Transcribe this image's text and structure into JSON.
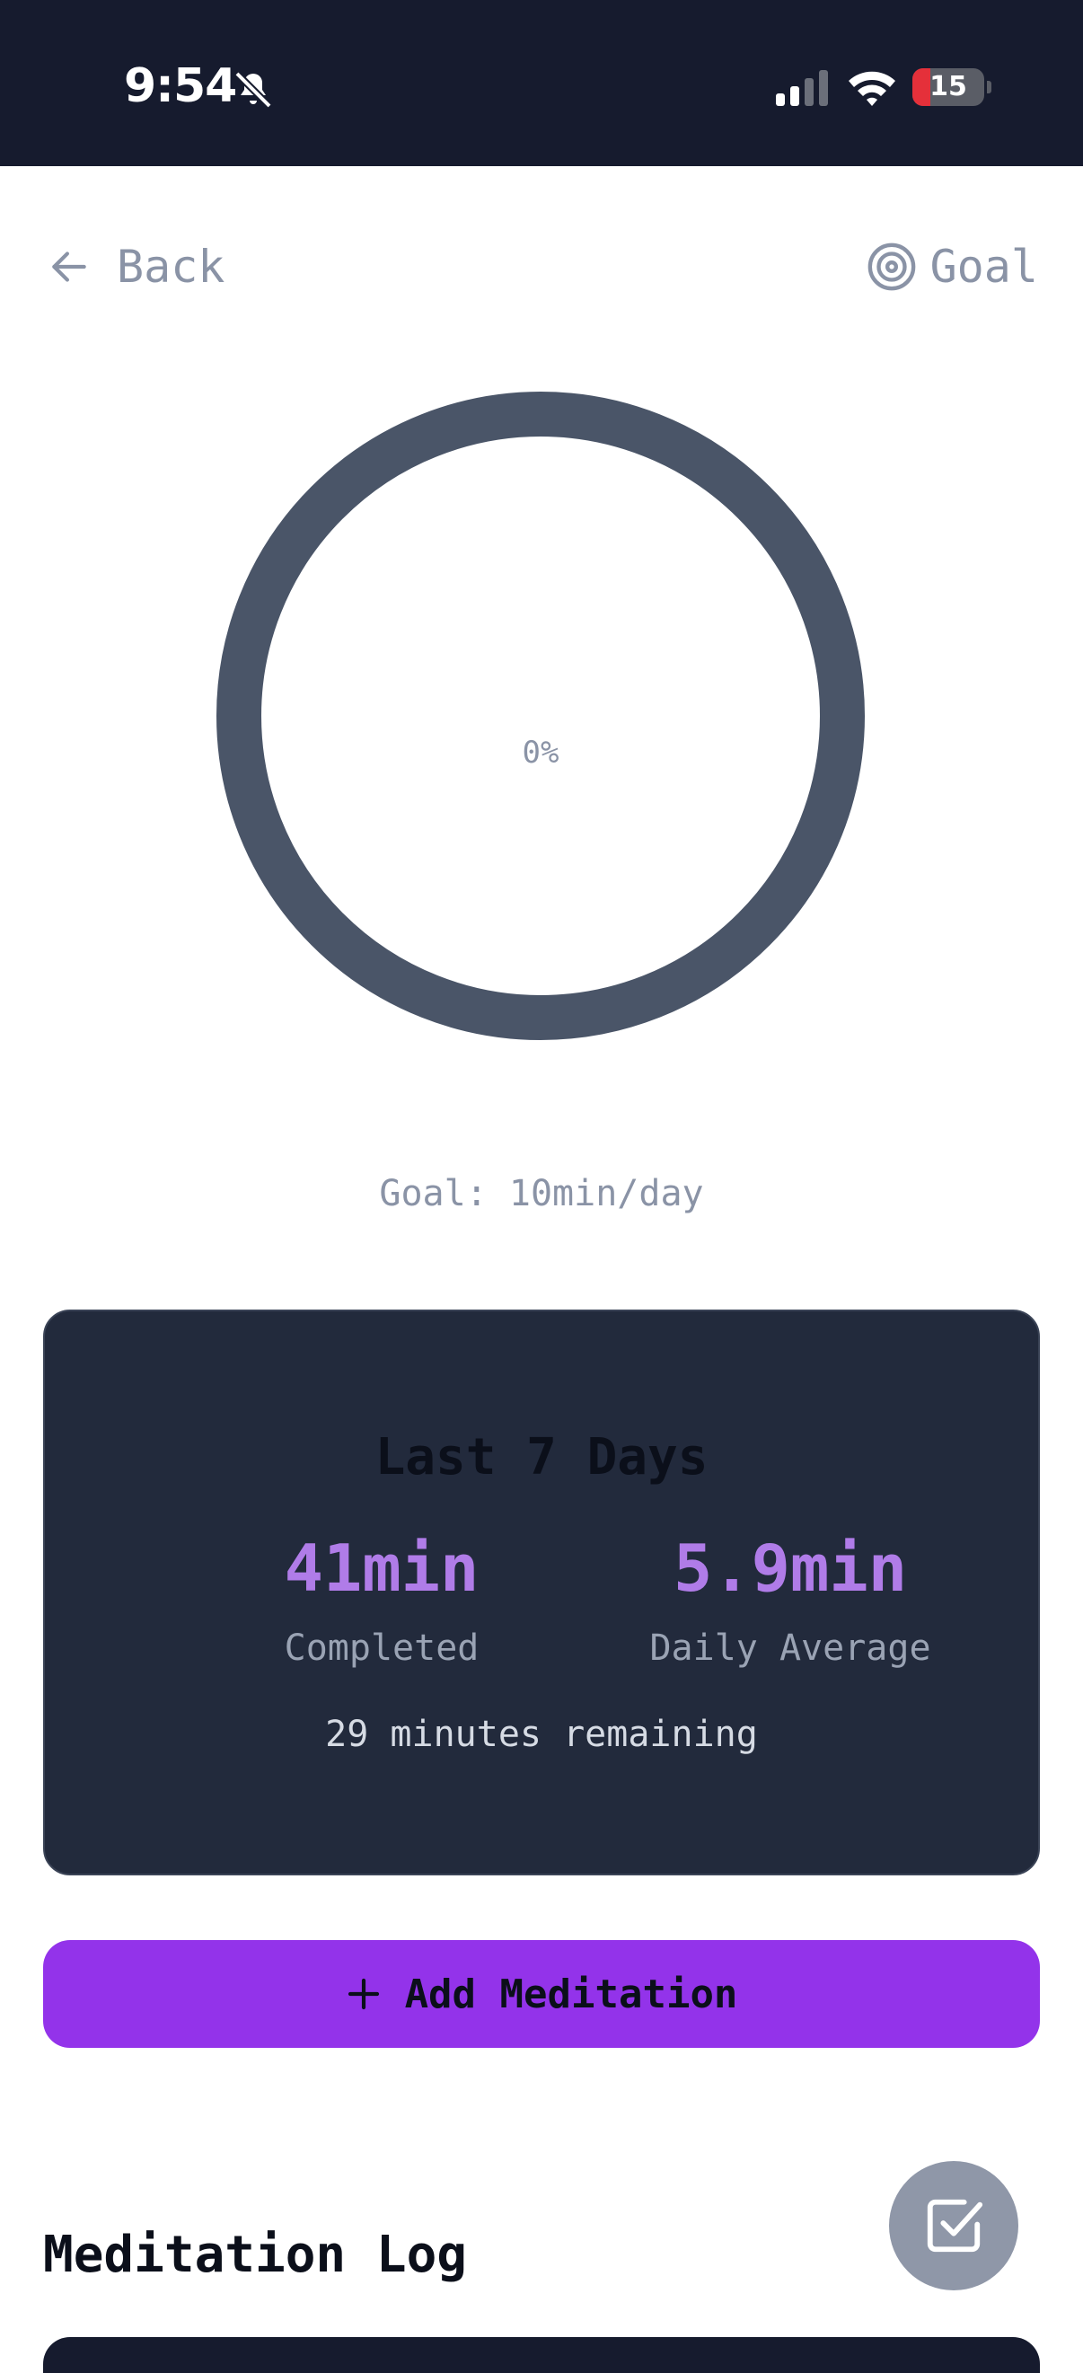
{
  "status_bar": {
    "time": "9:54",
    "battery_level": "15",
    "battery_fraction": 0.15
  },
  "header": {
    "back_label": "Back",
    "goal_label": "Goal"
  },
  "progress": {
    "percent_text": "0%",
    "fraction": 0,
    "goal_text": "Goal: 10min/day"
  },
  "stats": {
    "title": "Last 7 Days",
    "completed_value": "41min",
    "completed_label": "Completed",
    "average_value": "5.9min",
    "average_label": "Daily Average",
    "remaining_text": "29 minutes remaining"
  },
  "actions": {
    "add_label": "Add Meditation"
  },
  "log": {
    "title": "Meditation Log"
  },
  "icons": {
    "bell": "bell-slash-icon",
    "signal": "signal-icon",
    "wifi": "wifi-icon",
    "back": "arrow-left-icon",
    "goal": "target-icon",
    "add": "plus-icon",
    "fab": "check-square-icon"
  },
  "colors": {
    "accent": "#9333ea",
    "stat_value": "#b07ce8",
    "card_bg": "#222a3c",
    "ring": "#4a5568",
    "status_bar_bg": "#161b2e",
    "battery_low": "#e5303a",
    "muted_text": "#8a93a6"
  }
}
